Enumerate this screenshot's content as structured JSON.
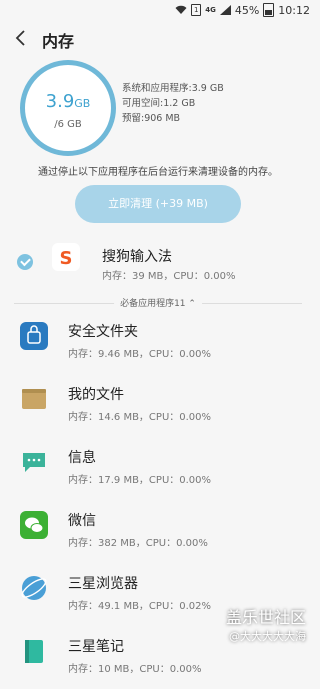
{
  "status": {
    "battery": "45%",
    "time": "10:12",
    "network": "4G",
    "sim": "1"
  },
  "header": {
    "title": "内存"
  },
  "memory": {
    "used_value": "3.9",
    "used_unit": "GB",
    "total": "/6 GB",
    "stats": [
      "系统和应用程序:3.9 GB",
      "可用空间:1.2 GB",
      "预留:906 MB"
    ],
    "description": "通过停止以下应用程序在后台运行来清理设备的内存。",
    "clean_button": "立即清理 (+39 MB)"
  },
  "selected_app": {
    "name": "搜狗输入法",
    "usage": "内存：39 MB，CPU：0.00%"
  },
  "essential_header": "必备应用程序11",
  "apps": [
    {
      "name": "安全文件夹",
      "usage": "内存：9.46 MB，CPU：0.00%",
      "icon": "secure-folder-icon",
      "color": "#2a7ac0"
    },
    {
      "name": "我的文件",
      "usage": "内存：14.6 MB，CPU：0.00%",
      "icon": "folder-icon",
      "color": "#c9a565"
    },
    {
      "name": "信息",
      "usage": "内存：17.9 MB，CPU：0.00%",
      "icon": "message-icon",
      "color": "#3bb39a"
    },
    {
      "name": "微信",
      "usage": "内存：382 MB，CPU：0.00%",
      "icon": "wechat-icon",
      "color": "#3cb034"
    },
    {
      "name": "三星浏览器",
      "usage": "内存：49.1 MB，CPU：0.02%",
      "icon": "browser-icon",
      "color": "#4a9fd6"
    },
    {
      "name": "三星笔记",
      "usage": "内存：10 MB，CPU：0.00%",
      "icon": "notes-icon",
      "color": "#2fb9a0"
    }
  ],
  "watermark": {
    "line1": "盖乐世社区",
    "line2": "@大大大大大海"
  }
}
